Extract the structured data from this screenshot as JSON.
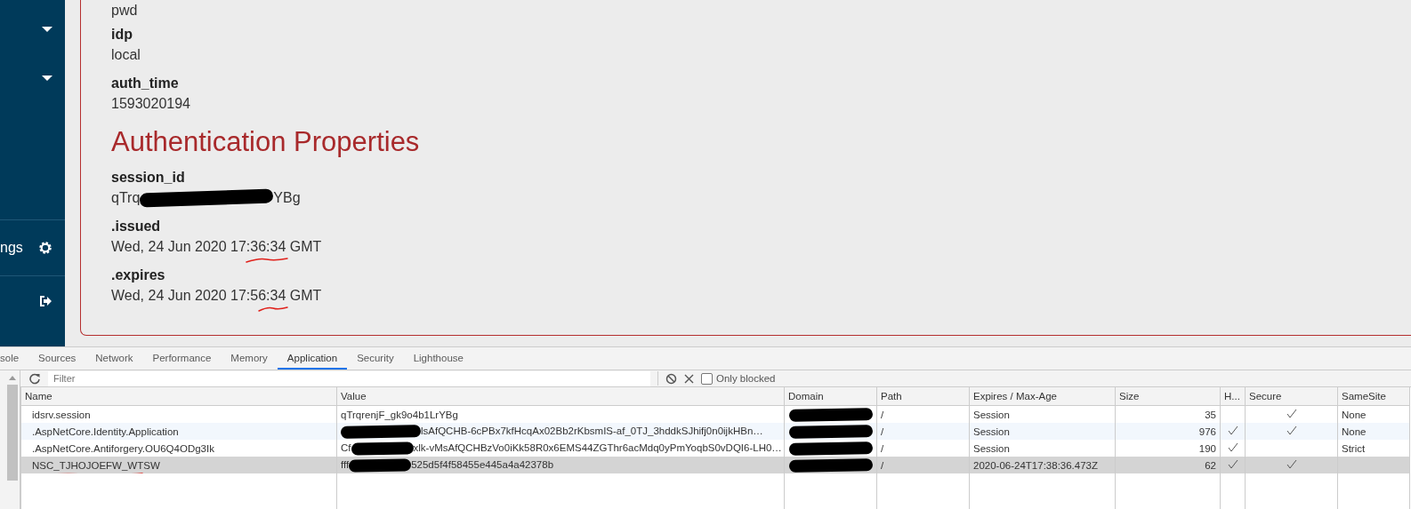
{
  "sidebar": {
    "items": [
      {
        "kind": "dropdown"
      },
      {
        "kind": "dropdown"
      },
      {
        "kind": "settings",
        "label": "ngs"
      },
      {
        "kind": "logout"
      }
    ]
  },
  "claims": {
    "partial_value": "pwd",
    "items": [
      {
        "label": "idp",
        "value": "local"
      },
      {
        "label": "auth_time",
        "value": "1593020194"
      }
    ]
  },
  "authentication_properties": {
    "heading": "Authentication Properties",
    "items": [
      {
        "label": "session_id",
        "value_before": "qTrq",
        "value_after": "YBg",
        "redacted": true,
        "annotated": false
      },
      {
        "label": ".issued",
        "value_before": "Wed, 24 Jun 2020 17:36:34 GMT",
        "redacted": false,
        "annotated": true
      },
      {
        "label": ".expires",
        "value_before": "Wed, 24 Jun 2020 17:56:34 GMT",
        "redacted": false,
        "annotated": true
      }
    ]
  },
  "devtools": {
    "tabs": [
      {
        "label": "sole",
        "selected": false
      },
      {
        "label": "Sources",
        "selected": false
      },
      {
        "label": "Network",
        "selected": false
      },
      {
        "label": "Performance",
        "selected": false
      },
      {
        "label": "Memory",
        "selected": false
      },
      {
        "label": "Application",
        "selected": true
      },
      {
        "label": "Security",
        "selected": false
      },
      {
        "label": "Lighthouse",
        "selected": false
      }
    ],
    "filter": {
      "placeholder": "Filter"
    },
    "only_blocked": {
      "label": "Only blocked",
      "checked": false
    },
    "table": {
      "columns": [
        "Name",
        "Value",
        "Domain",
        "Path",
        "Expires / Max-Age",
        "Size",
        "H...",
        "Secure",
        "SameSite"
      ],
      "rows": [
        {
          "name": "idsrv.session",
          "annotated": false,
          "value_before": "qTrqrenjF_gk9o4b1LrYBg",
          "value_redacted": false,
          "domain_redacted": true,
          "path": "/",
          "expires": "Session",
          "size": "35",
          "http_only": false,
          "secure": true,
          "same_site": "None",
          "selected": false
        },
        {
          "name": ".AspNetCore.Identity.Application",
          "annotated": false,
          "value_after": "lsAfQCHB-6cPBx7kfHcqAx02Bb2rKbsmIS-af_0TJ_3hddkSJhifj0n0ijkHBn…",
          "value_redacted": true,
          "domain_redacted": true,
          "path": "/",
          "expires": "Session",
          "size": "976",
          "http_only": true,
          "secure": true,
          "same_site": "None",
          "selected": false
        },
        {
          "name": ".AspNetCore.Antiforgery.OU6Q4ODg3Ik",
          "annotated": false,
          "value_before": "Cf",
          "value_after": "xlk-vMsAfQCHBzVo0iKk58R0x6EMS44ZGThr6acMdq0yPmYoqbS0vDQI6-LH0…",
          "value_redacted": true,
          "domain_redacted": true,
          "path": "/",
          "expires": "Session",
          "size": "190",
          "http_only": true,
          "secure": false,
          "same_site": "Strict",
          "selected": false
        },
        {
          "name": "NSC_TJHOJOEFW_WTSW",
          "annotated": true,
          "value_before": "fff",
          "value_after": "525d5f4f58455e445a4a42378b",
          "value_redacted": true,
          "domain_redacted": true,
          "path": "/",
          "expires": "2020-06-24T17:38:36.473Z",
          "size": "62",
          "http_only": true,
          "secure": true,
          "selected": true
        }
      ]
    }
  }
}
